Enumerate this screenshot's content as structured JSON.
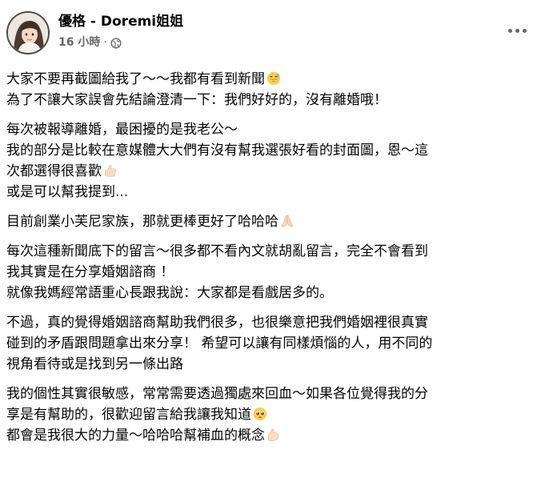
{
  "header": {
    "author": "優格 - Doremi姐姐",
    "time": "16 小時",
    "separator": "·",
    "privacy_icon": "globe-icon",
    "more_icon": "more-options-icon"
  },
  "post": {
    "paragraphs": [
      {
        "lines": [
          {
            "text": "大家不要再截圖給我了～～我都有看到新聞",
            "emoji": "grinning-sweat-emoji"
          },
          {
            "text": "為了不讓大家誤會先結論澄清一下：我們好好的，沒有離婚哦！"
          }
        ]
      },
      {
        "lines": [
          {
            "text": "每次被報導離婚，最困擾的是我老公～"
          },
          {
            "text": "我的部分是比較在意媒體大大們有沒有幫我選張好看的封面圖，恩～這"
          },
          {
            "text": "次都選得很喜歡",
            "emoji": "thumbs-up-emoji"
          },
          {
            "text": "或是可以幫我提到..."
          }
        ]
      },
      {
        "lines": [
          {
            "text": "目前創業小芙尼家族，那就更棒更好了哈哈哈",
            "emoji": "folded-hands-emoji"
          }
        ]
      },
      {
        "lines": [
          {
            "text": "每次這種新聞底下的留言～很多都不看內文就胡亂留言，完全不會看到"
          },
          {
            "text": "我其實是在分享婚姻諮商 ！"
          },
          {
            "text": "就像我媽經常語重心長跟我說：大家都是看戲居多的。"
          }
        ]
      },
      {
        "lines": [
          {
            "text": "不過，真的覺得婚姻諮商幫助我們很多，也很樂意把我們婚姻裡很真實"
          },
          {
            "text": "碰到的矛盾跟問題拿出來分享！ 希望可以讓有同樣煩惱的人，用不同的"
          },
          {
            "text": "視角看待或是找到另一條出路"
          }
        ]
      },
      {
        "lines": [
          {
            "text": "我的個性其實很敏感，常常需要透過獨處來回血～如果各位覺得我的分"
          },
          {
            "text": "享是有幫助的，很歡迎留言給我讓我知道",
            "emoji": "pleading-face-emoji"
          },
          {
            "text": "都會是我很大的力量～哈哈哈幫補血的概念",
            "emoji": "flexed-biceps-emoji"
          }
        ]
      }
    ]
  }
}
